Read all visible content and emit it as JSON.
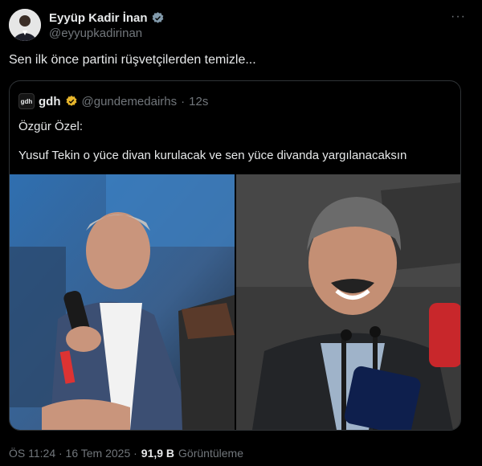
{
  "author": {
    "name": "Eyyüp Kadir İnan",
    "handle": "@eyyupkadirinan"
  },
  "tweet": {
    "text": "Sen ilk önce partini rüşvetçilerden temizle..."
  },
  "quoted": {
    "avatar_text": "gdh",
    "name": "gdh",
    "handle": "@gundemedairhs",
    "separator": "·",
    "time": "12s",
    "line1": "Özgür Özel:",
    "line2": "Yusuf Tekin o yüce divan kurulacak ve sen yüce divanda yargılanacaksın"
  },
  "meta": {
    "time": "ÖS 11:24 · 16 Tem 2025 ·",
    "views": "91,9 B",
    "views_label": "Görüntüleme"
  },
  "icons": {
    "verified_grey": "verified-grey-badge",
    "verified_gold": "verified-gold-badge",
    "more": "more-options-icon"
  },
  "colors": {
    "background": "#000000",
    "text": "#e7e9ea",
    "secondary": "#71767b",
    "border": "#2f3336",
    "gold": "#e8b62c",
    "grey_badge": "#829aab"
  }
}
